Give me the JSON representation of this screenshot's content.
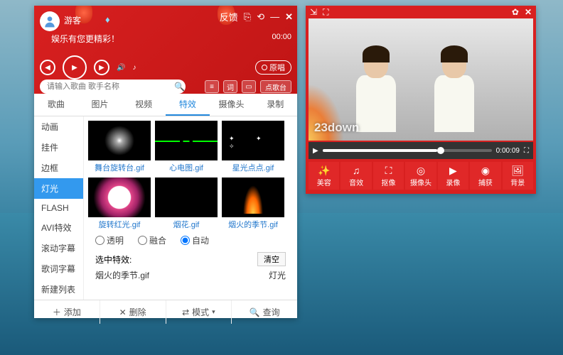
{
  "left": {
    "username": "游客",
    "tagline": "娱乐有您更精彩！",
    "feedback": "反馈",
    "time": "00:00",
    "original_label": "原唱",
    "search_placeholder": "请输入歌曲 歌手名称",
    "search_btn_ci": "词",
    "search_btn_ktv": "点歌台",
    "tabs": [
      "歌曲",
      "图片",
      "视频",
      "特效",
      "摄像头",
      "录制"
    ],
    "active_tab": 3,
    "sidebar": [
      "动画",
      "挂件",
      "边框",
      "灯光",
      "FLASH",
      "AVI特效",
      "滚动字幕",
      "歌词字幕",
      "新建列表"
    ],
    "active_sidebar": 3,
    "effects": [
      {
        "name": "舞台旋转台.gif",
        "cls": "th-burst"
      },
      {
        "name": "心电图.gif",
        "cls": "th-ecg"
      },
      {
        "name": "星光点点.gif",
        "cls": "th-stars"
      },
      {
        "name": "旋转红光.gif",
        "cls": "th-ring"
      },
      {
        "name": "烟花.gif",
        "cls": ""
      },
      {
        "name": "烟火的季节.gif",
        "cls": "th-fire"
      }
    ],
    "radios": [
      "透明",
      "融合",
      "自动"
    ],
    "radio_selected": 2,
    "selected_label": "选中特效:",
    "clear_btn": "清空",
    "selected_item": "烟火的季节.gif",
    "selected_category": "灯光",
    "bottom": [
      {
        "icon": "＋",
        "label": "添加"
      },
      {
        "icon": "✕",
        "label": "删除"
      },
      {
        "icon": "⇄",
        "label": "模式",
        "caret": true
      },
      {
        "icon": "🔍",
        "label": "查询"
      }
    ]
  },
  "right": {
    "watermark": "23down",
    "time": "0:00:09",
    "tools": [
      {
        "icon": "✨",
        "label": "美容"
      },
      {
        "icon": "♫",
        "label": "音效"
      },
      {
        "icon": "⛶",
        "label": "抠像"
      },
      {
        "icon": "◎",
        "label": "摄像头"
      },
      {
        "icon": "▶",
        "label": "录像"
      },
      {
        "icon": "◉",
        "label": "捕获"
      },
      {
        "icon": "🖼",
        "label": "背景"
      }
    ]
  }
}
